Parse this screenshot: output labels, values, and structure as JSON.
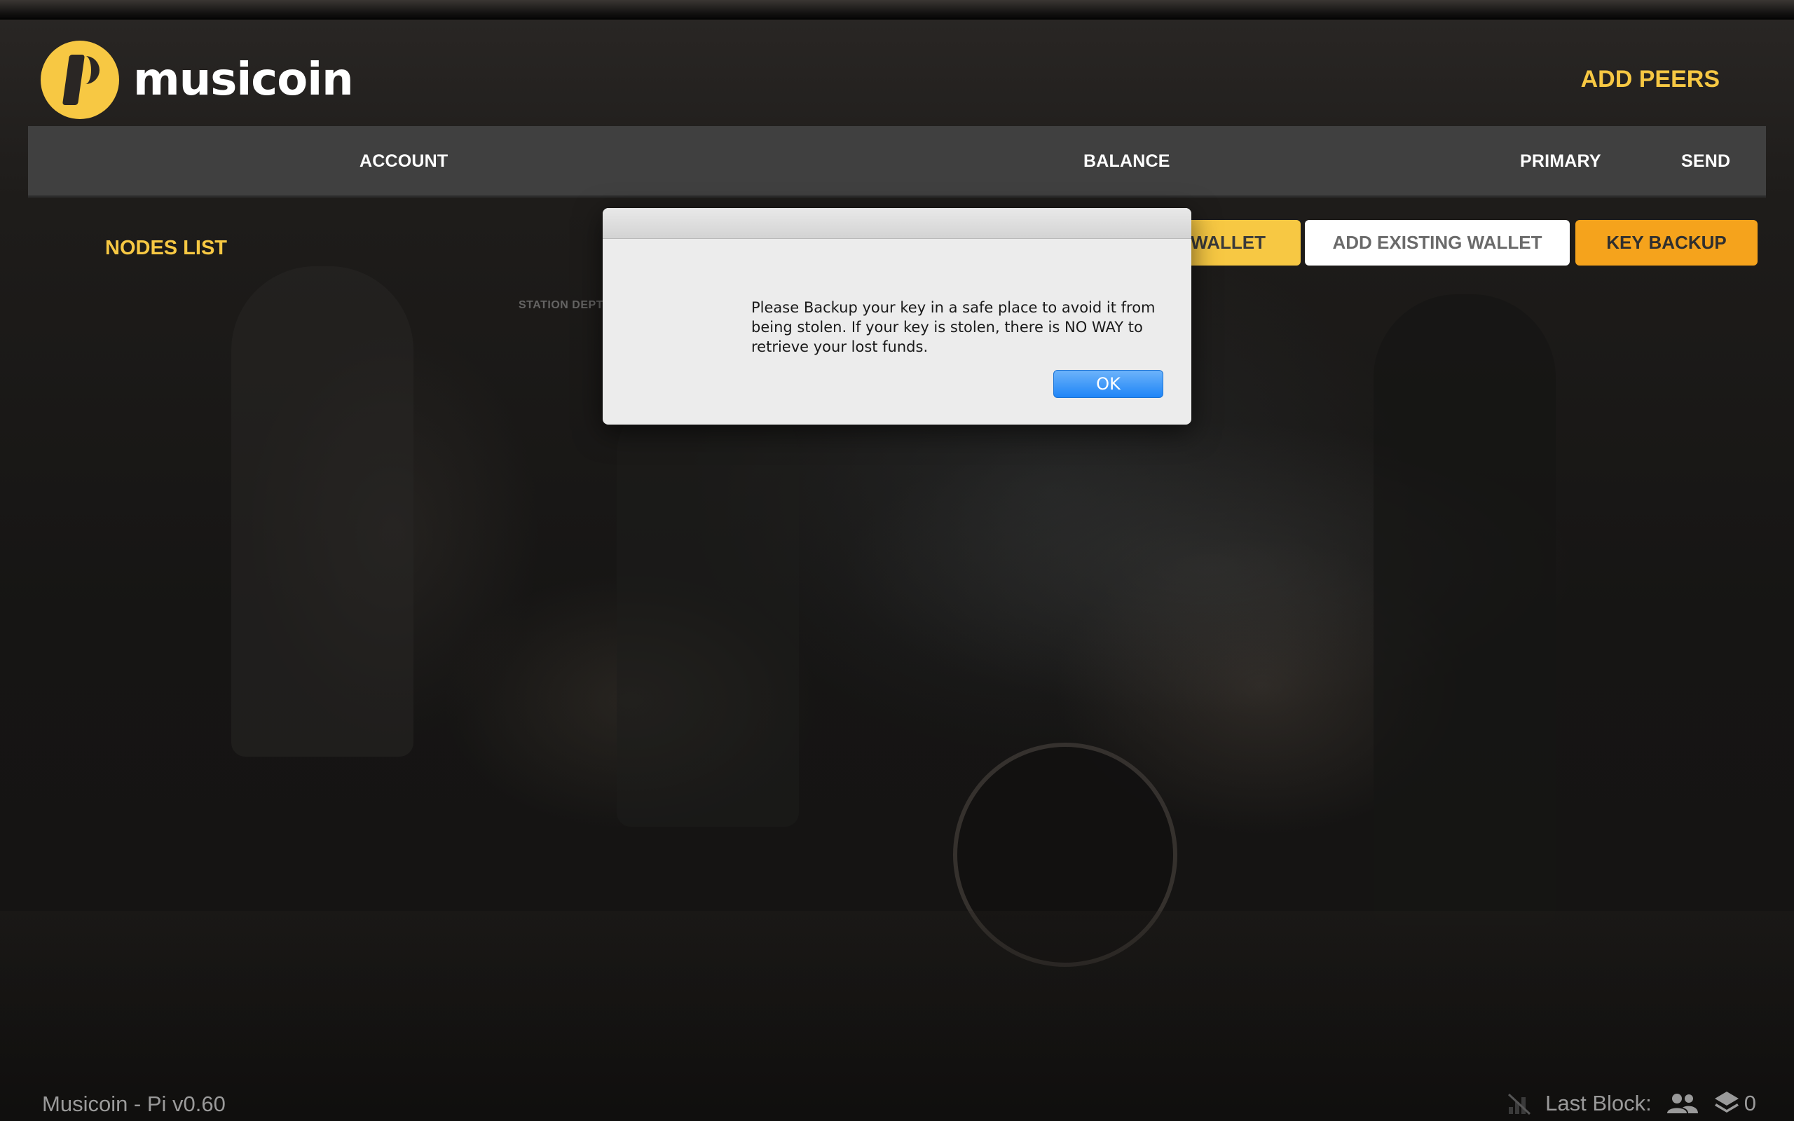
{
  "app": {
    "brand": "musicoin",
    "colors": {
      "accent": "#f7c843",
      "accent_orange": "#f5a31c",
      "bar": "#404040",
      "ok_blue": "#1f85f7"
    }
  },
  "header": {
    "add_peers_label": "ADD PEERS"
  },
  "table_header": {
    "columns": [
      "ACCOUNT",
      "BALANCE",
      "PRIMARY",
      "SEND"
    ]
  },
  "nav": {
    "nodes_list_label": "NODES LIST"
  },
  "actions": {
    "wallet_label": "WALLET",
    "add_existing_label": "ADD EXISTING WALLET",
    "key_backup_label": "KEY BACKUP"
  },
  "background": {
    "sign_text": "STATION DEPT"
  },
  "modal": {
    "message": "Please Backup your key in a safe place to avoid it from being stolen. If your key is stolen, there is NO WAY to retrieve your lost funds.",
    "ok_label": "OK"
  },
  "footer": {
    "version": "Musicoin - Pi v0.60",
    "last_block_label": "Last Block:",
    "block_count": "0",
    "icons": [
      "signal-icon",
      "peers-icon",
      "layers-icon"
    ]
  }
}
